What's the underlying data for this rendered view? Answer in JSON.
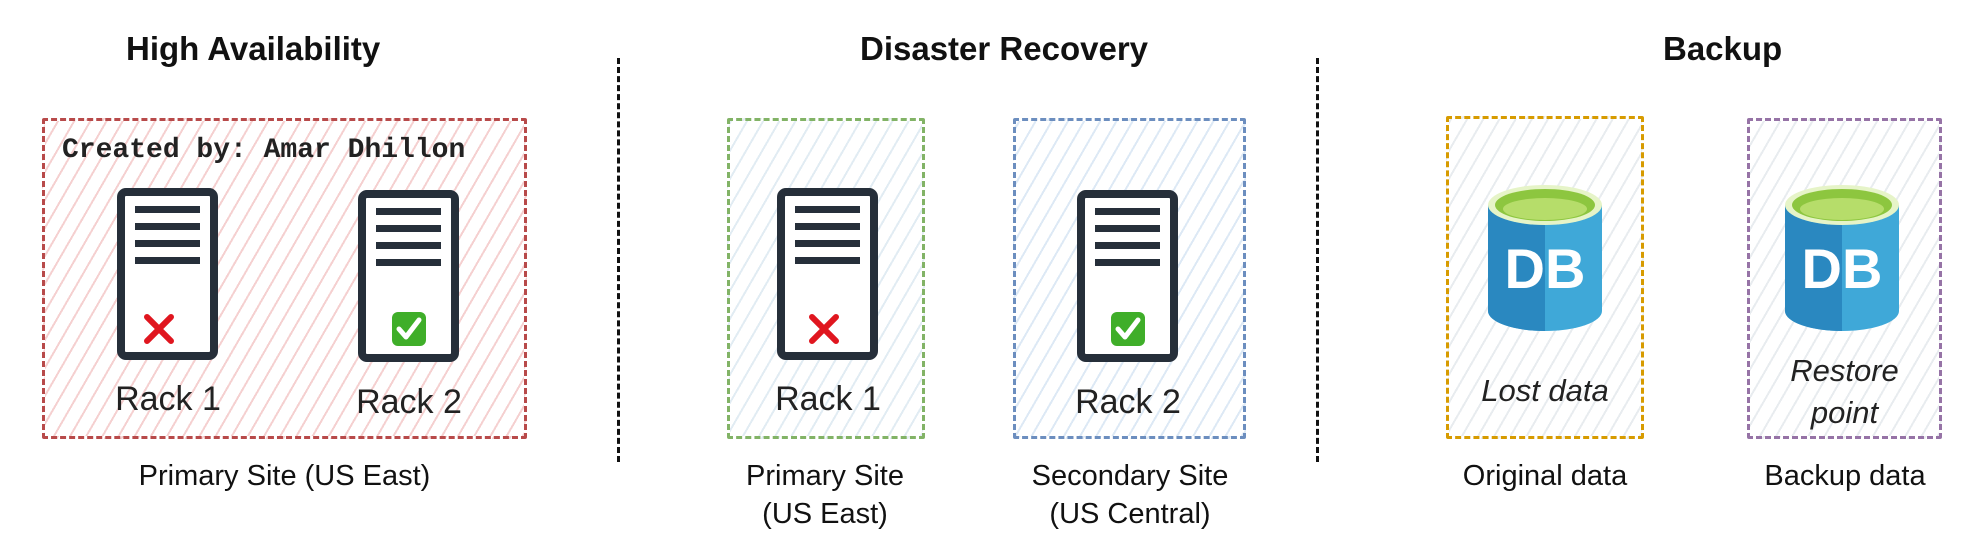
{
  "headings": {
    "high_availability": "High Availability",
    "disaster_recovery": "Disaster Recovery",
    "backup": "Backup"
  },
  "high_availability": {
    "creator_credit": "Created by: Amar Dhillon",
    "rack1": {
      "label": "Rack 1",
      "status": "failed",
      "status_icon": "red-x-icon"
    },
    "rack2": {
      "label": "Rack 2",
      "status": "ok",
      "status_icon": "green-check-icon"
    },
    "caption": "Primary Site (US East)"
  },
  "disaster_recovery": {
    "primary": {
      "rack_label": "Rack 1",
      "status": "failed",
      "caption_line1": "Primary Site",
      "caption_line2": "(US East)"
    },
    "secondary": {
      "rack_label": "Rack 2",
      "status": "ok",
      "caption_line1": "Secondary Site",
      "caption_line2": "(US Central)"
    }
  },
  "backup": {
    "original": {
      "db_text": "DB",
      "label": "Lost data",
      "caption": "Original data"
    },
    "restore": {
      "db_text": "DB",
      "label_line1": "Restore",
      "label_line2": "point",
      "caption": "Backup data"
    }
  },
  "colors": {
    "ha_border": "#b84a4a",
    "dr_primary_border": "#82b366",
    "dr_secondary_border": "#6c8ebf",
    "backup_original_border": "#d79b00",
    "backup_restore_border": "#9673a6",
    "db_blue": "#2d8fc4",
    "db_top_green": "#8dc63f"
  }
}
